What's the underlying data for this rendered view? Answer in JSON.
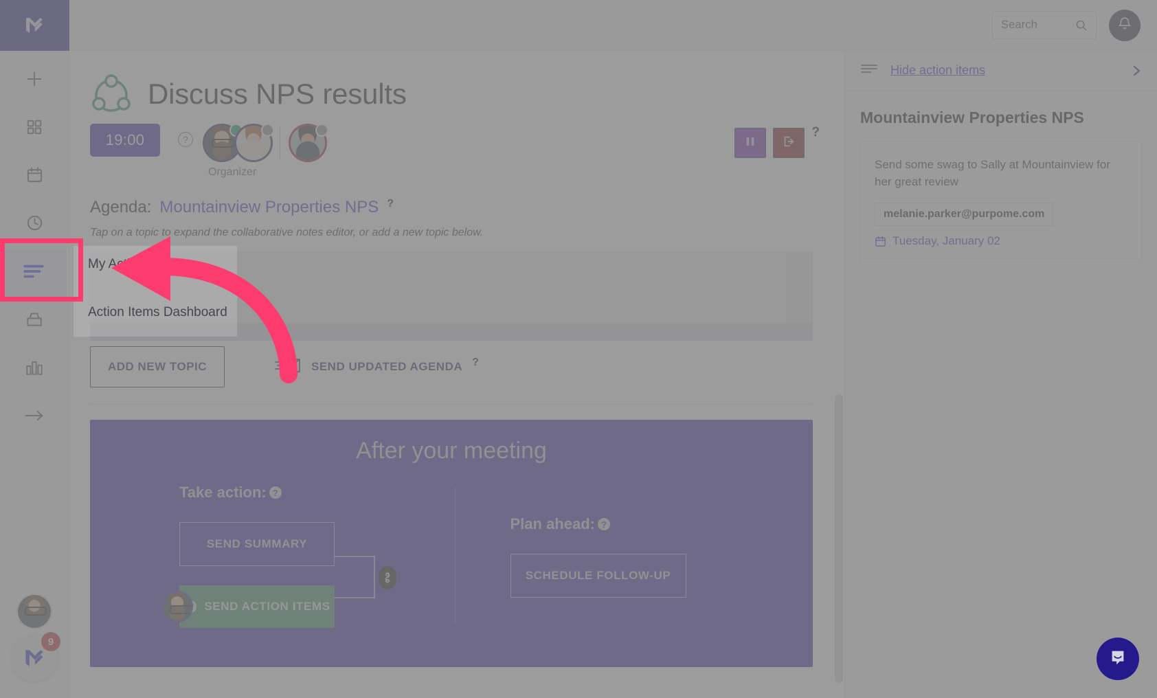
{
  "topbar": {
    "search": {
      "placeholder": "Search",
      "value": ""
    },
    "search_icon": "search-icon",
    "bell_icon": "bell-icon"
  },
  "sidebar": {
    "logo": "app-logo",
    "items": [
      {
        "id": "add",
        "icon": "plus-icon",
        "label": "Add"
      },
      {
        "id": "dashboard",
        "icon": "grid-icon",
        "label": "Dashboard"
      },
      {
        "id": "calendar",
        "icon": "calendar-icon",
        "label": "Calendar"
      },
      {
        "id": "history",
        "icon": "clock-icon",
        "label": "History"
      },
      {
        "id": "actions",
        "icon": "action-items-icon",
        "label": "Action Items",
        "active": true
      },
      {
        "id": "templates",
        "icon": "inbox-tray-icon",
        "label": "Templates"
      },
      {
        "id": "insights",
        "icon": "bar-chart-icon",
        "label": "Insights"
      },
      {
        "id": "collapse",
        "icon": "arrow-right-icon",
        "label": "Collapse"
      }
    ],
    "avatar": "user-avatar",
    "launcher_badge": "9"
  },
  "meeting": {
    "icon": "meeting-network-icon",
    "title": "Discuss NPS results",
    "timer": "19:00",
    "timer_help": "?",
    "organizer_label": "Organizer",
    "participants": [
      {
        "name": "Organizer avatar",
        "status": "online"
      },
      {
        "name": "Participant avatar",
        "status": "away"
      },
      {
        "name": "Guest avatar",
        "status": "away"
      }
    ],
    "controls": {
      "pause": "pause-icon",
      "exit": "exit-icon",
      "help": "?"
    }
  },
  "agenda": {
    "label": "Agenda:",
    "link": "Mountainview Properties NPS",
    "help": "?",
    "hint": "Tap on a topic to expand the collaborative notes editor, or add a new topic below.",
    "add_topic_label": "ADD NEW TOPIC",
    "send_agenda_label": "SEND UPDATED AGENDA",
    "send_agenda_help": "?",
    "send_agenda_icon": "envelope-send-icon"
  },
  "flyout": {
    "items": [
      {
        "label": "My Action Items"
      },
      {
        "label": "Action Items Dashboard"
      }
    ]
  },
  "after_meeting": {
    "title": "After your meeting",
    "take_action": {
      "heading": "Take action:",
      "help": "?",
      "send_summary": "SEND SUMMARY",
      "send_action_items": "SEND ACTION ITEMS",
      "send_action_items_icon": "check-circle-icon",
      "link_icon": "link-icon"
    },
    "plan_ahead": {
      "heading": "Plan ahead:",
      "help": "?",
      "schedule_follow_up": "SCHEDULE FOLLOW-UP"
    }
  },
  "right_panel": {
    "hide_label": "Hide action items",
    "hide_icon": "list-lines-icon",
    "collapse_icon": "chevron-right-icon",
    "title": "Mountainview Properties NPS",
    "cards": [
      {
        "text": "Send some swag to Sally at Mountainview for her great review",
        "assignee": "melanie.parker@purpome.com",
        "date": "Tuesday, January 02",
        "date_icon": "calendar-icon"
      }
    ]
  },
  "intercom": {
    "icon": "chat-bubble-icon"
  },
  "annotation": {
    "highlight": "sidebar-item-actions",
    "arrow": "pink-arrow-pointer"
  },
  "colors": {
    "brand_indigo": "#2d1f9e",
    "brand_dark": "#241a8c",
    "link": "#3c2fbf",
    "accent_pink": "#fc3c6e",
    "green": "#2f8a5f",
    "red": "#7c0f12",
    "purple": "#6b1fa8",
    "scrim": "#808080"
  }
}
